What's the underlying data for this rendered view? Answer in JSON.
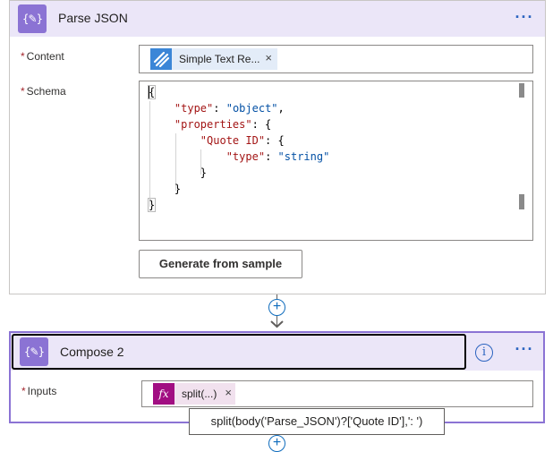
{
  "parse_json": {
    "title": "Parse JSON",
    "icon": "curly-braces-pencil-icon",
    "more_label": "···",
    "content_label": "Content",
    "content_token": {
      "label": "Simple Text Re...",
      "icon": "microsoft-forms-icon",
      "remove": "×"
    },
    "schema_label": "Schema",
    "generate_button": "Generate from sample",
    "required_mark": "*"
  },
  "schema_lines": [
    {
      "indent": "",
      "parts": [
        {
          "t": "p",
          "v": "{"
        }
      ]
    },
    {
      "indent": "    ",
      "parts": [
        {
          "t": "k",
          "v": "\"type\""
        },
        {
          "t": "p",
          "v": ": "
        },
        {
          "t": "s",
          "v": "\"object\""
        },
        {
          "t": "p",
          "v": ","
        }
      ]
    },
    {
      "indent": "    ",
      "parts": [
        {
          "t": "k",
          "v": "\"properties\""
        },
        {
          "t": "p",
          "v": ": {"
        }
      ]
    },
    {
      "indent": "        ",
      "parts": [
        {
          "t": "k",
          "v": "\"Quote ID\""
        },
        {
          "t": "p",
          "v": ": {"
        }
      ]
    },
    {
      "indent": "            ",
      "parts": [
        {
          "t": "k",
          "v": "\"type\""
        },
        {
          "t": "p",
          "v": ": "
        },
        {
          "t": "s",
          "v": "\"string\""
        }
      ]
    },
    {
      "indent": "        ",
      "parts": [
        {
          "t": "p",
          "v": "}"
        }
      ]
    },
    {
      "indent": "    ",
      "parts": [
        {
          "t": "p",
          "v": "}"
        }
      ]
    },
    {
      "indent": "",
      "parts": [
        {
          "t": "p",
          "v": "}"
        }
      ]
    }
  ],
  "compose": {
    "title": "Compose 2",
    "icon": "curly-braces-pencil-icon",
    "info_label": "i",
    "more_label": "···",
    "inputs_label": "Inputs",
    "fx_token": {
      "icon_label": "fx",
      "label": "split(...)",
      "remove": "×"
    },
    "tooltip": "split(body('Parse_JSON')?['Quote ID'],': ')"
  },
  "connector": {
    "add_step_label": "+"
  },
  "colors": {
    "card_header": "#ebe6f8",
    "action_icon": "#8b73d4",
    "json_key": "#a31515",
    "json_string": "#0451a5",
    "fx_token": "#a10e82",
    "forms_token": "#3b86d7",
    "link_blue": "#2c64c0"
  }
}
